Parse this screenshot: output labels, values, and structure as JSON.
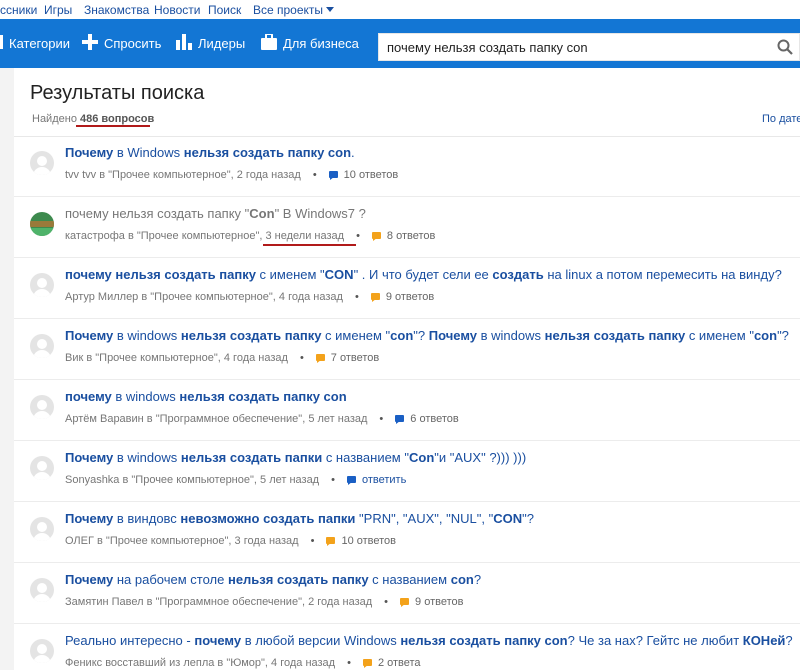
{
  "topnav": {
    "items": [
      "ссники",
      "Игры",
      "Знакомства",
      "Новости",
      "Поиск",
      "Все проекты"
    ]
  },
  "header": {
    "categories_label": "Категории",
    "ask_label": "Спросить",
    "leaders_label": "Лидеры",
    "business_label": "Для бизнеса",
    "search_value": "почему нельзя создать папку con"
  },
  "page": {
    "title": "Результаты поиска",
    "found_prefix": "Найдено",
    "found_count": "486 вопросов",
    "sort_by_date": "По дате"
  },
  "results": [
    {
      "parts": [
        [
          "Почему",
          true
        ],
        [
          " в Windows ",
          false
        ],
        [
          "нельзя создать папку con",
          true
        ],
        [
          ".",
          false
        ]
      ],
      "author": "tvv tvv",
      "category": " в \"Прочее компьютерное\", ",
      "time": "2 года назад",
      "answers": "10 ответов",
      "bubble": "blue",
      "visited": false,
      "avatar": "default"
    },
    {
      "parts": [
        [
          "почему нельзя создать папку",
          false
        ],
        [
          " \"",
          false
        ],
        [
          "Con",
          true
        ],
        [
          "\" В Windows7 ?",
          false
        ]
      ],
      "author": "катастрофа",
      "category": " в \"Прочее компьютерное\", ",
      "time": "3 недели назад",
      "answers": "8 ответов",
      "bubble": "orange",
      "visited": true,
      "avatar": "pic"
    },
    {
      "parts": [
        [
          "почему нельзя создать папку",
          true
        ],
        [
          " с именем \"",
          false
        ],
        [
          "CON",
          true
        ],
        [
          "\" . И что будет сели ее ",
          false
        ],
        [
          "создать",
          true
        ],
        [
          " на linux а потом перемесить на винду?",
          false
        ]
      ],
      "author": "Артур Миллер",
      "category": " в \"Прочее компьютерное\", ",
      "time": "4 года назад",
      "answers": "9 ответов",
      "bubble": "orange",
      "visited": false,
      "avatar": "default"
    },
    {
      "parts": [
        [
          "Почему",
          true
        ],
        [
          " в windows ",
          false
        ],
        [
          "нельзя создать папку",
          true
        ],
        [
          " с именем \"",
          false
        ],
        [
          "con",
          true
        ],
        [
          "\"? ",
          false
        ],
        [
          "Почему",
          true
        ],
        [
          " в windows ",
          false
        ],
        [
          "нельзя создать папку",
          true
        ],
        [
          " с именем \"",
          false
        ],
        [
          "con",
          true
        ],
        [
          "\"?",
          false
        ]
      ],
      "author": "Вик",
      "category": " в \"Прочее компьютерное\", ",
      "time": "4 года назад",
      "answers": "7 ответов",
      "bubble": "orange",
      "visited": false,
      "avatar": "default"
    },
    {
      "parts": [
        [
          "почему",
          true
        ],
        [
          " в windows ",
          false
        ],
        [
          "нельзя создать папку con",
          true
        ]
      ],
      "author": "Артём Варавин",
      "category": " в \"Программное обеспечение\", ",
      "time": "5 лет назад",
      "answers": "6 ответов",
      "bubble": "blue",
      "visited": false,
      "avatar": "default"
    },
    {
      "parts": [
        [
          "Почему",
          true
        ],
        [
          " в windows ",
          false
        ],
        [
          "нельзя создать папки",
          true
        ],
        [
          " с названием \"",
          false
        ],
        [
          "Con",
          true
        ],
        [
          "\"и \"AUX\" ?))) )))",
          false
        ]
      ],
      "author": "Sonyashka",
      "category": " в \"Прочее компьютерное\", ",
      "time": "5 лет назад",
      "answers": "ответить",
      "bubble": "blue",
      "visited": false,
      "avatar": "default",
      "answer_link": true
    },
    {
      "parts": [
        [
          "Почему",
          true
        ],
        [
          " в виндовс ",
          false
        ],
        [
          "невозможно создать папки",
          true
        ],
        [
          " \"PRN\", \"AUX\", \"NUL\", \"",
          false
        ],
        [
          "CON",
          true
        ],
        [
          "\"?",
          false
        ]
      ],
      "author": "ОЛЕГ",
      "category": " в \"Прочее компьютерное\", ",
      "time": "3 года назад",
      "answers": "10 ответов",
      "bubble": "orange",
      "visited": false,
      "avatar": "default"
    },
    {
      "parts": [
        [
          "Почему",
          true
        ],
        [
          " на рабочем столе ",
          false
        ],
        [
          "нельзя создать папку",
          true
        ],
        [
          " с названием ",
          false
        ],
        [
          "con",
          true
        ],
        [
          "?",
          false
        ]
      ],
      "author": "Замятин Павел",
      "category": " в \"Программное обеспечение\", ",
      "time": "2 года назад",
      "answers": "9 ответов",
      "bubble": "orange",
      "visited": false,
      "avatar": "default"
    },
    {
      "parts": [
        [
          "Реально интересно - ",
          false
        ],
        [
          "почему",
          true
        ],
        [
          " в любой версии Windows ",
          false
        ],
        [
          "нельзя создать папку con",
          true
        ],
        [
          "? Че за нах? Гейтс не любит ",
          false
        ],
        [
          "КОНей",
          true
        ],
        [
          "?",
          false
        ]
      ],
      "author": "Феникс восставший из лепла",
      "category": " в \"Юмор\", ",
      "time": "4 года назад",
      "answers": "2 ответа",
      "bubble": "orange",
      "visited": false,
      "avatar": "default"
    }
  ],
  "colors": {
    "header": "#1376d4",
    "link": "#1a4fa0",
    "underline": "#b11a1a",
    "bubble_blue": "#1a5fc4",
    "bubble_orange": "#f3a21b"
  }
}
